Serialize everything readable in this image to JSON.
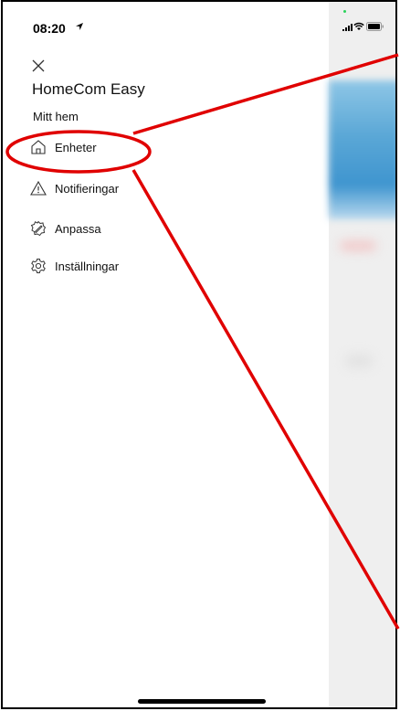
{
  "status_bar": {
    "time": "08:20"
  },
  "drawer": {
    "app_title": "HomeCom Easy",
    "home_name": "Mitt hem",
    "menu": [
      {
        "label": "Enheter",
        "icon": "home-icon"
      },
      {
        "label": "Notifieringar",
        "icon": "warning-icon"
      },
      {
        "label": "Anpassa",
        "icon": "customize-icon"
      },
      {
        "label": "Inställningar",
        "icon": "gear-icon"
      }
    ]
  },
  "annotation": {
    "color": "#e00000",
    "highlighted_item": "Enheter"
  }
}
